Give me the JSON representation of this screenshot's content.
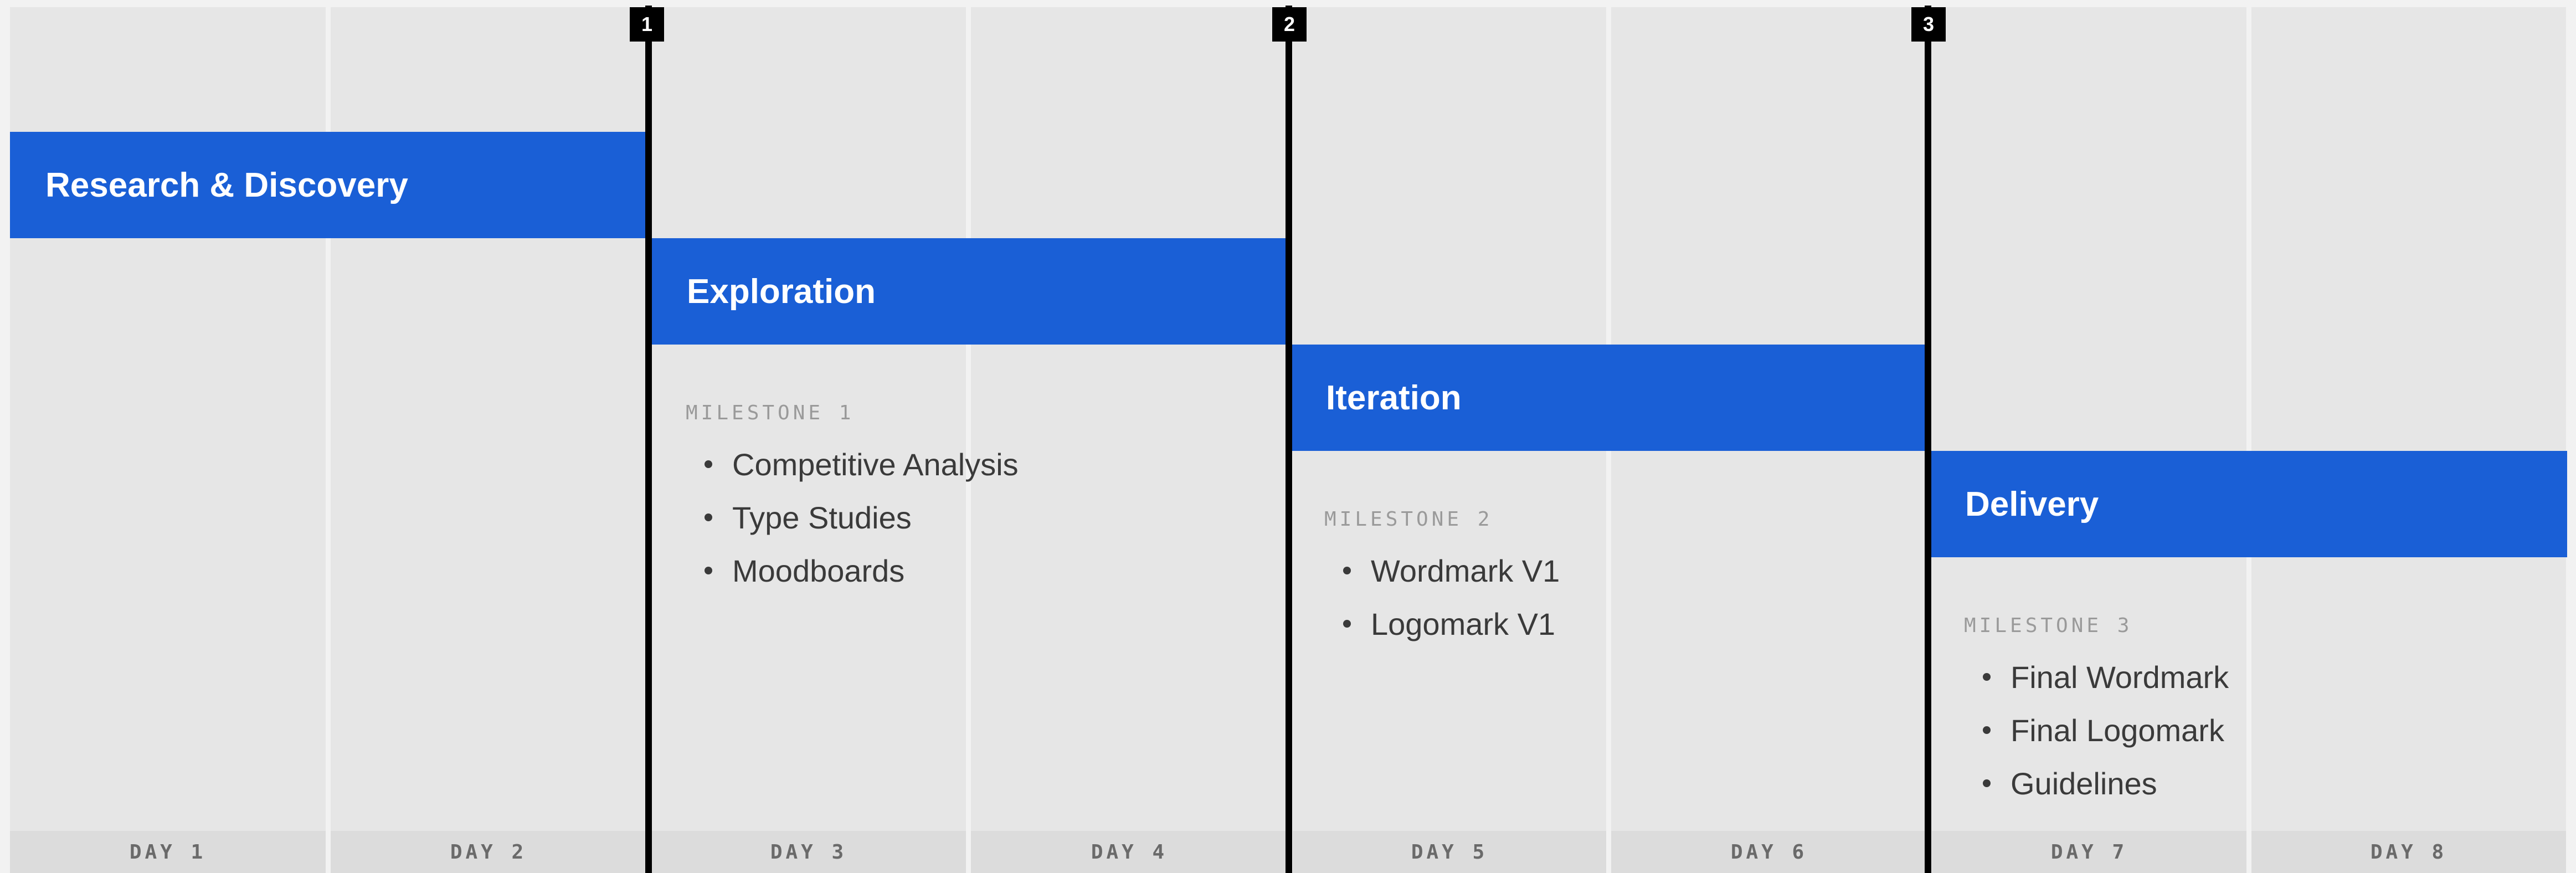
{
  "days": [
    "DAY 1",
    "DAY 2",
    "DAY 3",
    "DAY 4",
    "DAY 5",
    "DAY 6",
    "DAY 7",
    "DAY 8"
  ],
  "milestone_numbers": [
    "1",
    "2",
    "3"
  ],
  "phases": [
    {
      "label": "Research & Discovery"
    },
    {
      "label": "Exploration"
    },
    {
      "label": "Iteration"
    },
    {
      "label": "Delivery"
    }
  ],
  "milestones": [
    {
      "title": "MILESTONE 1",
      "items": [
        "Competitive Analysis",
        "Type Studies",
        "Moodboards"
      ]
    },
    {
      "title": "MILESTONE 2",
      "items": [
        "Wordmark V1",
        "Logomark V1"
      ]
    },
    {
      "title": "MILESTONE 3",
      "items": [
        "Final Wordmark",
        "Final Logomark",
        "Guidelines"
      ]
    }
  ],
  "colors": {
    "phase_bar": "#1a5fd6",
    "column": "#e6e6e6",
    "day_label_bg": "#dcdcdc",
    "milestone_line": "#000000"
  }
}
